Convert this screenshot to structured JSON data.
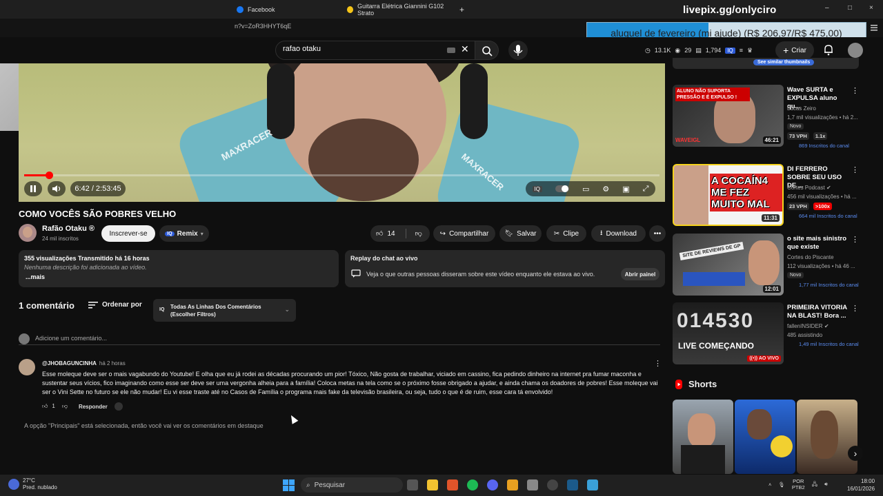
{
  "browser": {
    "tabs": [
      {
        "label": "Facebook"
      },
      {
        "label": "Guitarra Elétrica Giannini G102 Strato"
      }
    ],
    "new_tab": "+",
    "url_fragment": "n?v=ZoR3HHYT6qE",
    "window_controls": [
      "–",
      "□",
      "×"
    ]
  },
  "stream_overlay": {
    "top_text": "livepix.gg/onlyciro",
    "donation_goal": "aluguel de fevereiro (mi ajude) (R$ 206,97/R$ 475,00)",
    "donation_progress": 0.436
  },
  "header": {
    "search_value": "rafao otaku",
    "stats": {
      "views": "13.1K",
      "viewers": "29",
      "chat": "1,794"
    },
    "create_label": "Criar"
  },
  "player": {
    "time": "6:42 / 2:53:45",
    "progress": 0.039
  },
  "video": {
    "title": "COMO VOCÊS SÃO POBRES VELHO",
    "channel_name": "Rafão Otaku ®",
    "channel_subs": "24 mil inscritos",
    "subscribe_label": "Inscrever-se",
    "remix_label": "Remix",
    "likes": "14",
    "share_label": "Compartilhar",
    "save_label": "Salvar",
    "clip_label": "Clipe",
    "download_label": "Download",
    "more_label": "•••"
  },
  "description": {
    "stats": "355 visualizações  Transmitido há 16 horas",
    "text": "Nenhuma descrição foi adicionada ao vídeo.",
    "more": "...mais"
  },
  "chat_replay": {
    "heading": "Replay do chat ao vivo",
    "body": "Veja o que outras pessoas disseram sobre este vídeo enquanto ele estava ao vivo.",
    "button": "Abrir painel"
  },
  "comments": {
    "count_label": "1 comentário",
    "sort_label": "Ordenar por",
    "filter_line1": "Todas As Linhas Dos Comentários",
    "filter_line2": "(Escolher Filtros)",
    "add_placeholder": "Adicione um comentário...",
    "items": [
      {
        "author": "@JHOBAGUNCINHA",
        "time": "há 2 horas",
        "text": "Esse moleque deve ser o mais vagabundo do Youtube! E olha que eu já rodei as décadas procurando um pior! Tóxico, Não gosta de trabalhar, viciado em cassino, fica pedindo dinheiro na internet pra fumar maconha e sustentar seus vícios, fico imaginando como esse ser deve ser uma vergonha alheia para a família! Coloca metas na tela como se o próximo fosse obrigado a ajudar, e ainda chama os doadores de pobres! Esse moleque vai ser o Vini Sette no futuro se ele não mudar! Eu vi esse traste até no Casos de Família o programa mais fake da televisão brasileira, ou seja, tudo o que é de ruim, esse cara tá envolvido!",
        "likes": "1",
        "reply_label": "Responder"
      }
    ],
    "selected_note": "A opção \"Principais\" está selecionada, então você vai ver os comentários em destaque"
  },
  "sidebar": {
    "top_chip": "See similar thumbnails",
    "recommendations": [
      {
        "title": "Wave SURTA e EXPULSA aluno qu...",
        "channel": "Lucas Zeiro",
        "meta": "1,7 mil visualizações • há 2...",
        "badge": "Novo",
        "vph": "73 VPH",
        "mult": "1.1x",
        "subs": "869 Inscritos do canal",
        "duration": "46:21",
        "thumb_text": "ALUNO NÃO SUPORTA PRESSÃO E É EXPULSO !",
        "thumb_tag": "WAVEIGL"
      },
      {
        "title": "DI FERRERO SOBRE SEU USO DE ...",
        "channel": "Cortes Podcast",
        "meta": "456 mil visualizações • há ...",
        "vph": "23 VPH",
        "mult": ">100x",
        "subs": "664 mil Inscritos do canal",
        "duration": "11:31",
        "thumb_text": "A COCAÍN4 ME FEZ MUITO MAL"
      },
      {
        "title": "o site mais sinistro que existe",
        "channel": "Cortes do Piscante",
        "meta": "112 visualizações • há 46 ...",
        "badge": "Novo",
        "subs": "1,77 mil Inscritos do canal",
        "duration": "12:01",
        "thumb_text": "SITE DE REVIEWS DE GP"
      },
      {
        "title": "PRIMEIRA VITORIA NA BLAST! Bora ...",
        "channel": "fallenINSIDER",
        "meta": "485 assistindo",
        "subs": "1,49 mil Inscritos do canal",
        "live_label": "AO VIVO",
        "thumb_text": "LIVE COMEÇANDO",
        "thumb_digits": "014530"
      }
    ],
    "shorts_label": "Shorts",
    "shorts_next": "›"
  },
  "taskbar": {
    "weather_temp": "27°C",
    "weather_desc": "Pred. nublado",
    "search_label": "Pesquisar",
    "lang_top": "POR",
    "lang_bottom": "PTB2",
    "time": "18:00",
    "date": "16/01/2026"
  },
  "colors": {
    "accent": "#ff0000",
    "link": "#3ea6ff",
    "background": "#0f0f0f",
    "surface": "#272727"
  }
}
